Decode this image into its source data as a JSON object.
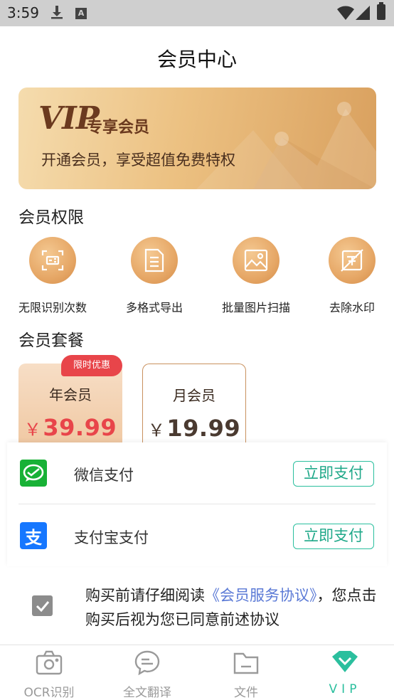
{
  "status_bar": {
    "time": "3:59",
    "a_icon_letter": "A"
  },
  "page_title": "会员中心",
  "banner": {
    "vip_text": "VIP",
    "vip_label": "专享会员",
    "subtitle": "开通会员，享受超值免费特权"
  },
  "privileges": {
    "title": "会员权限",
    "items": [
      {
        "label": "无限识别次数",
        "icon": "scan-icon"
      },
      {
        "label": "多格式导出",
        "icon": "document-icon"
      },
      {
        "label": "批量图片扫描",
        "icon": "image-icon"
      },
      {
        "label": "去除水印",
        "icon": "no-watermark-icon"
      }
    ]
  },
  "plans": {
    "title": "会员套餐",
    "badge": "限时优惠",
    "items": [
      {
        "name": "年会员",
        "currency": "￥",
        "price": "39.99",
        "selected": true
      },
      {
        "name": "月会员",
        "currency": "￥",
        "price": "19.99",
        "selected": false
      }
    ]
  },
  "payment": {
    "methods": [
      {
        "label": "微信支付",
        "button": "立即支付",
        "icon": "wechat-pay-icon",
        "color": "#18b136"
      },
      {
        "label": "支付宝支付",
        "button": "立即支付",
        "icon": "alipay-icon",
        "icon_glyph": "支",
        "color": "#1677ff"
      }
    ]
  },
  "agreement": {
    "prefix": "购买前请仔细阅读",
    "link": "《会员服务协议》",
    "suffix": "，您点击购买后视为您已同意前述协议",
    "checked": true
  },
  "bottom_nav": {
    "items": [
      {
        "label": "OCR识别",
        "icon": "camera-icon"
      },
      {
        "label": "全文翻译",
        "icon": "chat-translate-icon"
      },
      {
        "label": "文件",
        "icon": "folder-icon"
      },
      {
        "label": "VIP",
        "icon": "diamond-icon",
        "active": true
      }
    ],
    "accent_color": "#2bbf9e"
  }
}
